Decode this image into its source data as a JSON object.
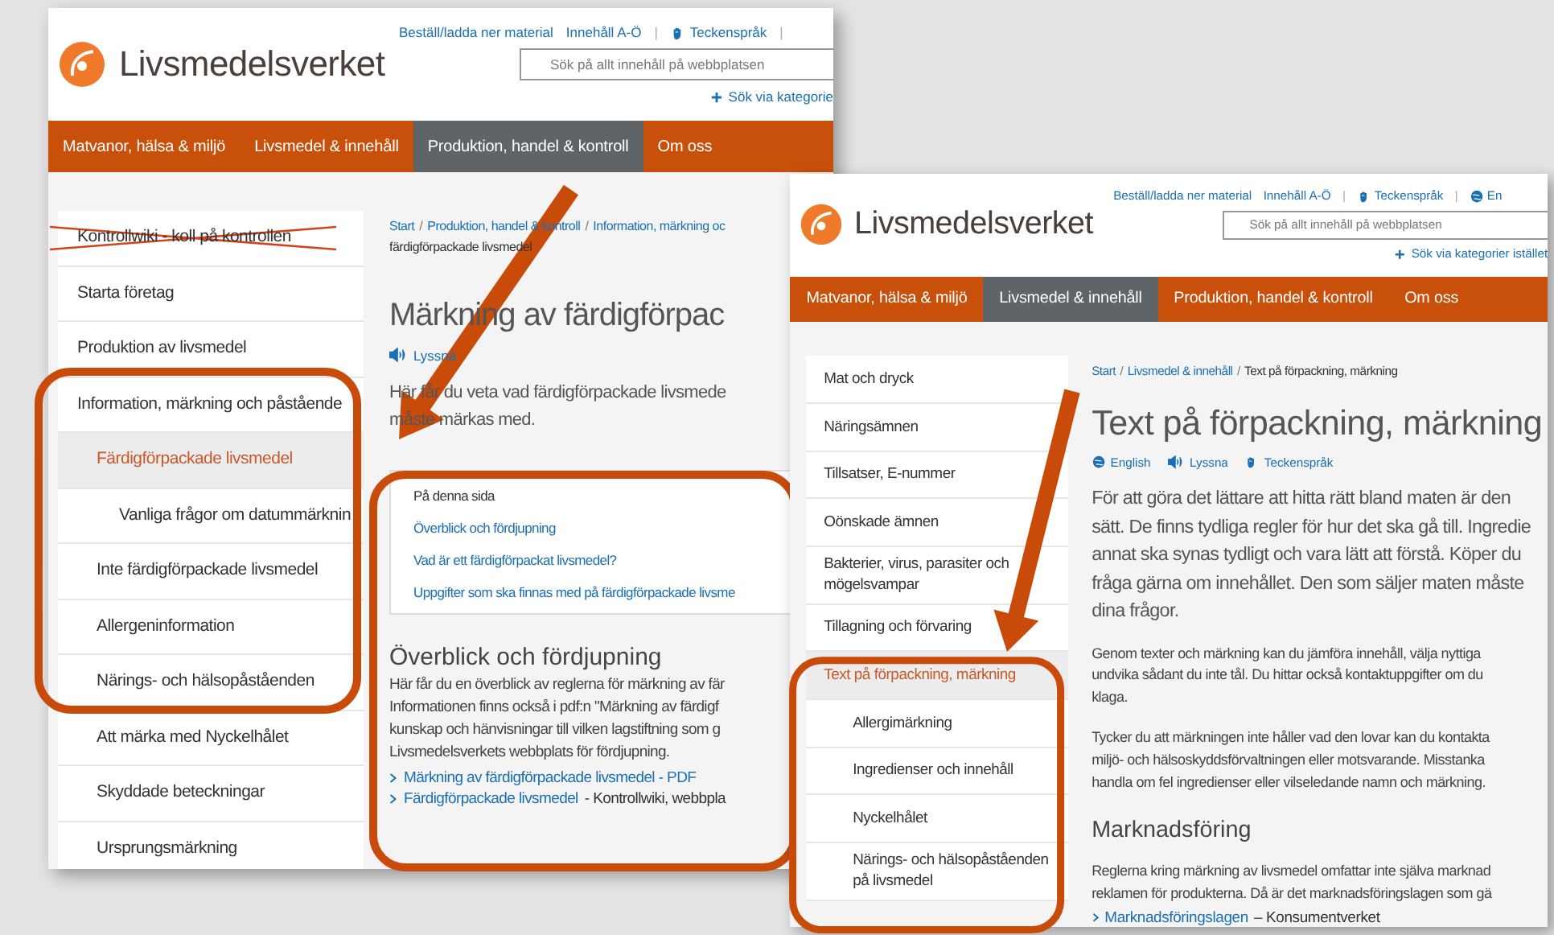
{
  "screenshots": [
    {
      "logo": "Livsmedelsverket",
      "top_links": [
        {
          "kind": "text",
          "label": "Beställ/ladda ner material"
        },
        {
          "kind": "text",
          "label": "Innehåll A-Ö"
        },
        {
          "kind": "separator",
          "label": "|"
        },
        {
          "kind": "sign_language",
          "label": "Teckenspråk"
        },
        {
          "kind": "separator",
          "label": "|"
        }
      ],
      "search": {
        "placeholder": "Sök på allt innehåll på webbplatsen"
      },
      "category_link": "Sök via kategorie",
      "nav": [
        {
          "label": "Matvanor, hälsa & miljö",
          "selected": false
        },
        {
          "label": "Livsmedel & innehåll",
          "selected": false
        },
        {
          "label": "Produktion, handel & kontroll",
          "selected": true
        },
        {
          "label": "Om oss",
          "selected": false
        }
      ],
      "sidebar": [
        {
          "label": "Kontrollwiki - koll på kontrollen",
          "selected": false,
          "crossed_out": true
        },
        {
          "label": "Starta företag",
          "selected": false,
          "crossed_out": false
        },
        {
          "label": "Produktion av livsmedel",
          "selected": false,
          "crossed_out": false
        },
        {
          "label": "Information, märkning och påstående",
          "selected": false,
          "crossed_out": false,
          "children": [
            {
              "label": "Färdigförpackade livsmedel",
              "selected": true,
              "crossed_out": false,
              "children": [
                {
                  "label": "Vanliga frågor om datummärknin",
                  "selected": false,
                  "crossed_out": false
                }
              ]
            },
            {
              "label": "Inte färdigförpackade livsmedel",
              "selected": false,
              "crossed_out": false
            },
            {
              "label": "Allergeninformation",
              "selected": false,
              "crossed_out": false
            },
            {
              "label": "Närings- och hälsopåståenden",
              "selected": false,
              "crossed_out": false
            },
            {
              "label": "Att märka med Nyckelhålet",
              "selected": false,
              "crossed_out": false
            },
            {
              "label": "Skyddade beteckningar",
              "selected": false,
              "crossed_out": false
            },
            {
              "label": "Ursprungsmärkning",
              "selected": false,
              "crossed_out": false
            }
          ]
        }
      ],
      "breadcrumb": [
        {
          "kind": "link",
          "label": "Start"
        },
        {
          "kind": "separator",
          "label": "/"
        },
        {
          "kind": "link",
          "label": "Produktion, handel & kontroll"
        },
        {
          "kind": "separator",
          "label": "/"
        },
        {
          "kind": "link",
          "label": "Information, märkning oc"
        },
        {
          "kind": "current",
          "label": "färdigförpackade livsmedel"
        }
      ],
      "title": "Märkning av färdigförpac",
      "tools": [
        {
          "kind": "listen",
          "label": "Lyssna"
        }
      ],
      "blocks": [
        {
          "kind": "lead",
          "lines": [
            "Här får du veta vad färdigförpackade livsmede",
            "måste märkas med."
          ]
        },
        {
          "kind": "toc",
          "heading": "På denna sida",
          "links": [
            "Överblick och fördjupning",
            "Vad är ett färdigförpackat livsmedel?",
            "Uppgifter som ska finnas med på färdigförpackade livsme"
          ]
        },
        {
          "kind": "heading",
          "text": "Överblick och fördjupning"
        },
        {
          "kind": "paragraph",
          "lines": [
            "Här får du en överblick av reglerna för märkning av fär",
            "Informationen finns också i pdf:n \"Märkning av färdigf",
            "kunskap och hänvisningar till vilken lagstiftning som g",
            "Livsmedelsverkets webbplats för fördjupning."
          ]
        },
        {
          "kind": "link",
          "link": "Märkning av färdigförpackade livsmedel - PDF"
        },
        {
          "kind": "link",
          "link": "Färdigförpackade livsmedel",
          "rest": "- Kontrollwiki, webbpla"
        }
      ]
    },
    {
      "logo": "Livsmedelsverket",
      "top_links": [
        {
          "kind": "text",
          "label": "Beställ/ladda ner material"
        },
        {
          "kind": "text",
          "label": "Innehåll A-Ö"
        },
        {
          "kind": "separator",
          "label": "|"
        },
        {
          "kind": "sign_language",
          "label": "Teckenspråk"
        },
        {
          "kind": "separator",
          "label": "|"
        },
        {
          "kind": "language",
          "label": "En"
        }
      ],
      "search": {
        "placeholder": "Sök på allt innehåll på webbplatsen"
      },
      "category_link": "Sök via kategorier istället",
      "nav": [
        {
          "label": "Matvanor, hälsa & miljö",
          "selected": false
        },
        {
          "label": "Livsmedel & innehåll",
          "selected": true
        },
        {
          "label": "Produktion, handel & kontroll",
          "selected": false
        },
        {
          "label": "Om oss",
          "selected": false
        }
      ],
      "sidebar": [
        {
          "label": "Mat och dryck",
          "selected": false,
          "crossed_out": false
        },
        {
          "label": "Näringsämnen",
          "selected": false,
          "crossed_out": false
        },
        {
          "label": "Tillsatser, E-nummer",
          "selected": false,
          "crossed_out": false
        },
        {
          "label": "Oönskade ämnen",
          "selected": false,
          "crossed_out": false
        },
        {
          "label": "Bakterier, virus, parasiter och mögelsvampar",
          "selected": false,
          "crossed_out": false
        },
        {
          "label": "Tillagning och förvaring",
          "selected": false,
          "crossed_out": false
        },
        {
          "label": "Text på förpackning, märkning",
          "selected": true,
          "crossed_out": false,
          "children": [
            {
              "label": "Allergimärkning",
              "selected": false,
              "crossed_out": false
            },
            {
              "label": "Ingredienser och innehåll",
              "selected": false,
              "crossed_out": false
            },
            {
              "label": "Nyckelhålet",
              "selected": false,
              "crossed_out": false
            },
            {
              "label": "Närings- och hälsopåståenden på livsmedel",
              "selected": false,
              "crossed_out": false
            }
          ]
        }
      ],
      "breadcrumb": [
        {
          "kind": "link",
          "label": "Start"
        },
        {
          "kind": "separator",
          "label": "/"
        },
        {
          "kind": "link",
          "label": "Livsmedel & innehåll"
        },
        {
          "kind": "separator",
          "label": "/"
        },
        {
          "kind": "current",
          "label": "Text på förpackning, märkning"
        }
      ],
      "title": "Text på förpackning, märkning",
      "tools": [
        {
          "kind": "language",
          "label": "English"
        },
        {
          "kind": "listen",
          "label": "Lyssna"
        },
        {
          "kind": "sign_language",
          "label": "Teckenspråk"
        }
      ],
      "blocks": [
        {
          "kind": "lead",
          "lines": [
            "För att göra det lättare att hitta rätt bland maten är den",
            "sätt. De finns tydliga regler för hur det ska gå till. Ingredie",
            "annat ska synas tydligt och vara lätt att förstå. Köper du",
            "fråga gärna om innehållet. Den som säljer maten måste",
            "dina frågor."
          ]
        },
        {
          "kind": "paragraph",
          "lines": [
            "Genom texter och märkning kan du jämföra innehåll, välja nyttiga",
            "undvika sådant du inte tål. Du hittar också kontaktuppgifter om du",
            "klaga."
          ]
        },
        {
          "kind": "paragraph",
          "lines": [
            "Tycker du att märkningen inte håller vad den lovar kan du kontakta",
            "miljö- och hälsoskyddsförvaltningen eller motsvarande. Misstanka",
            "handla om fel ingredienser eller vilseledande namn och märkning."
          ]
        },
        {
          "kind": "heading",
          "text": "Marknadsföring"
        },
        {
          "kind": "paragraph",
          "lines": [
            "Reglerna kring märkning av livsmedel omfattar inte själva marknad",
            "reklamen för produkterna. Då är det marknadsföringslagen som gä"
          ]
        },
        {
          "kind": "link",
          "link": "Marknadsföringslagen",
          "rest": "– Konsumentverket"
        }
      ]
    }
  ]
}
